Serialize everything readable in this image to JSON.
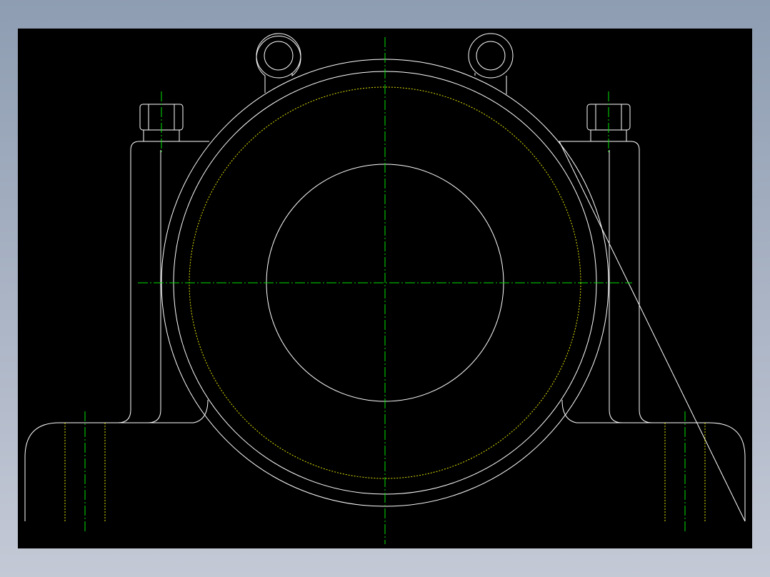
{
  "viewer": {
    "background_top": "#8e9db2",
    "background_bottom": "#c4c9d6",
    "canvas_color": "#000000"
  },
  "drawing": {
    "subject": "plummer-block-bearing-housing-front-view",
    "outline_color": "#ffffff",
    "centerline_color": "#00e000",
    "hidden_line_color": "#e0e000",
    "parts": [
      "base-plate",
      "pedestal-body",
      "bearing-housing-outer",
      "bearing-housing-inner",
      "bearing-pitch-circle",
      "shaft-bore",
      "lifting-eye-left",
      "lifting-eye-right",
      "cap-bolt-left",
      "cap-bolt-right",
      "foot-bolt-hole-left",
      "foot-bolt-hole-right"
    ]
  }
}
